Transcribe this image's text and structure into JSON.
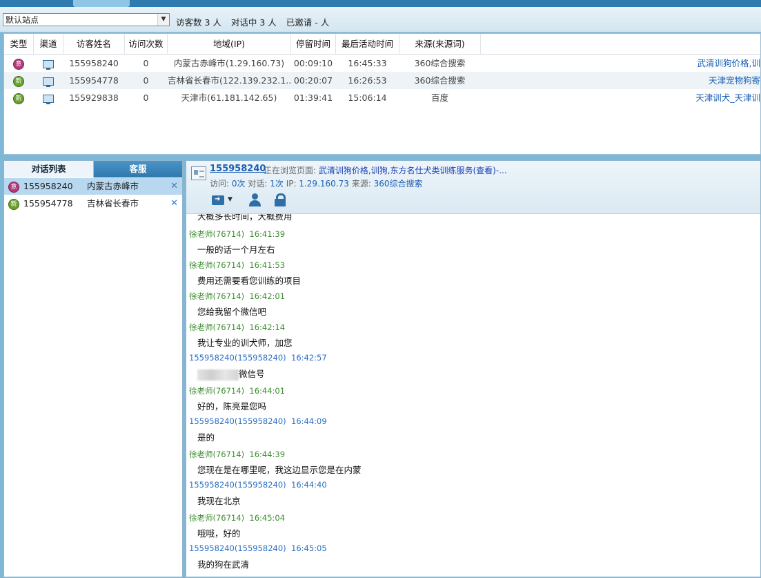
{
  "toolbar": {
    "site_select": "默认站点",
    "visitor_count": "访客数 3 人",
    "in_chat": "对话中 3 人",
    "invited": "已邀请 - 人"
  },
  "visitor_table": {
    "columns": [
      "类型",
      "渠道",
      "访客姓名",
      "访问次数",
      "地域(IP)",
      "停留时间",
      "最后活动时间",
      "来源(来源词)"
    ],
    "rows": [
      {
        "type_badge": "意",
        "name": "155958240",
        "visits": "0",
        "region": "内蒙古赤峰市(1.29.160.73)",
        "stay": "00:09:10",
        "last_active": "16:45:33",
        "source": "360综合搜索",
        "keyword": "武清训狗价格,训"
      },
      {
        "type_badge": "新",
        "name": "155954778",
        "visits": "0",
        "region": "吉林省长春市(122.139.232.1...",
        "stay": "00:20:07",
        "last_active": "16:26:53",
        "source": "360综合搜索",
        "keyword": "天津宠物狗寄"
      },
      {
        "type_badge": "新",
        "name": "155929838",
        "visits": "0",
        "region": "天津市(61.181.142.65)",
        "stay": "01:39:41",
        "last_active": "15:06:14",
        "source": "百度",
        "keyword": "天津训犬_天津训"
      }
    ]
  },
  "left_panel": {
    "tab_chats": "对话列表",
    "tab_service": "客服",
    "chats": [
      {
        "badge": "意",
        "id": "155958240",
        "location": "内蒙古赤峰市",
        "close": "✕"
      },
      {
        "badge": "新",
        "id": "155954778",
        "location": "吉林省长春市",
        "close": "✕"
      }
    ]
  },
  "chat_header": {
    "visitor_id": "155958240",
    "browsing_label": "正在浏览页面:",
    "browsing_page": "武清训狗价格,训狗,东方名仕犬类训练服务(查看)-...",
    "visits_label": "访问:",
    "visits": "0次",
    "chats_label": "对话:",
    "chats": "1次",
    "ip_label": "IP:",
    "ip": "1.29.160.73",
    "source_label": "来源:",
    "source": "360综合搜索"
  },
  "messages": {
    "partial_top": "大概多长时间，大概费用",
    "items": [
      {
        "role": "agent",
        "sender": "徐老师(76714)",
        "time": "16:41:39",
        "text": "一般的话一个月左右"
      },
      {
        "role": "agent",
        "sender": "徐老师(76714)",
        "time": "16:41:53",
        "text": "费用还需要看您训练的项目"
      },
      {
        "role": "agent",
        "sender": "徐老师(76714)",
        "time": "16:42:01",
        "text": "您给我留个微信吧"
      },
      {
        "role": "agent",
        "sender": "徐老师(76714)",
        "time": "16:42:14",
        "text": "我让专业的训犬师，加您"
      },
      {
        "role": "visitor",
        "sender": "155958240(155958240)",
        "time": "16:42:57",
        "text": "微信号",
        "blurred": true
      },
      {
        "role": "agent",
        "sender": "徐老师(76714)",
        "time": "16:44:01",
        "text": "好的，陈亮是您吗"
      },
      {
        "role": "visitor",
        "sender": "155958240(155958240)",
        "time": "16:44:09",
        "text": "是的"
      },
      {
        "role": "agent",
        "sender": "徐老师(76714)",
        "time": "16:44:39",
        "text": "您现在是在哪里呢，我这边显示您是在内蒙"
      },
      {
        "role": "visitor",
        "sender": "155958240(155958240)",
        "time": "16:44:40",
        "text": "我现在北京"
      },
      {
        "role": "agent",
        "sender": "徐老师(76714)",
        "time": "16:45:04",
        "text": "哦哦，好的"
      },
      {
        "role": "visitor",
        "sender": "155958240(155958240)",
        "time": "16:45:05",
        "text": "我的狗在武清"
      }
    ]
  },
  "colors": {
    "agent": "#3c8d2f",
    "visitor": "#2a6fc4",
    "badge_intent": "#b43a7a",
    "badge_new": "#6aa12c",
    "selected_row": "#b8d8f0"
  }
}
